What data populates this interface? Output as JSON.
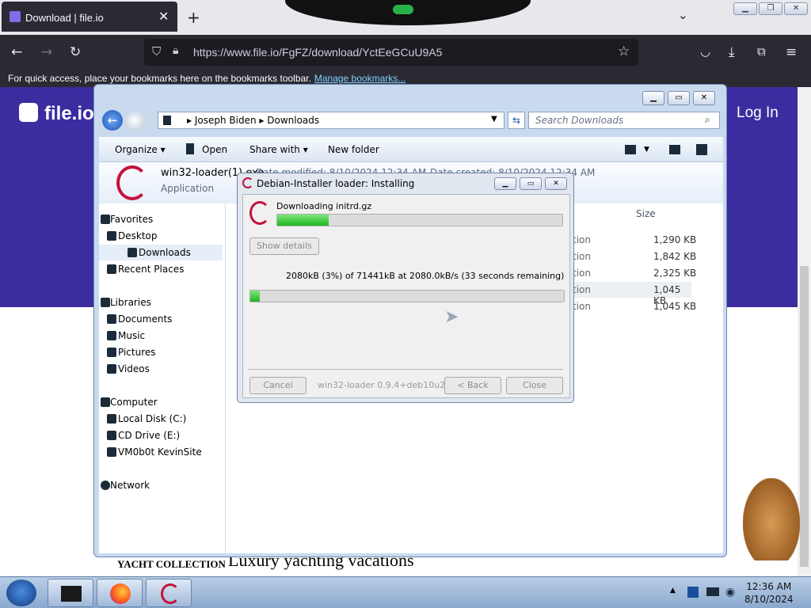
{
  "browser": {
    "tab_title": "Download | file.io",
    "new_tab": "+",
    "url": "https://www.file.io/FgFZ/download/YctEeGCuU9A5",
    "bookmarks_text": "For quick access, place your bookmarks here on the bookmarks toolbar.",
    "bookmarks_link": "Manage bookmarks..."
  },
  "site": {
    "logo": "file.io",
    "login": "Log In",
    "yacht_a": "YACHT COLLECTION",
    "yacht_b": "Luxury yachting vacations"
  },
  "explorer": {
    "breadcrumb": [
      "Joseph Biden",
      "Downloads"
    ],
    "search_placeholder": "Search Downloads",
    "commands": [
      "Organize ▾",
      "Open",
      "Share with ▾",
      "New folder"
    ],
    "selected_file": {
      "name": "win32-loader(1).exe",
      "type": "Application",
      "date_modified": "Date modified: 8/10/2024 12:34 AM",
      "date_created": "Date created: 8/10/2024 12:34 AM"
    },
    "nav": {
      "favorites": "Favorites",
      "fav_items": [
        "Desktop",
        "Downloads",
        "Recent Places"
      ],
      "libraries": "Libraries",
      "lib_items": [
        "Documents",
        "Music",
        "Pictures",
        "Videos"
      ],
      "computer": "Computer",
      "comp_items": [
        "Local Disk (C:)",
        "CD Drive (E:)",
        "VM0b0t KevinSite"
      ],
      "network": "Network"
    },
    "size_header": "Size",
    "rows": [
      {
        "type": "tion",
        "size": "1,290 KB"
      },
      {
        "type": "tion",
        "size": "1,842 KB"
      },
      {
        "type": "tion",
        "size": "2,325 KB"
      },
      {
        "type": "tion",
        "size": "1,045 KB"
      },
      {
        "type": "tion",
        "size": "1,045 KB"
      }
    ]
  },
  "dialog": {
    "title": "Debian-Installer loader: Installing",
    "status": "Downloading initrd.gz",
    "status_progress": 0.18,
    "show_details": "Show details",
    "transfer": "2080kB (3%) of 71441kB at 2080.0kB/s (33 seconds remaining)",
    "transfer_progress": 0.03,
    "cancel": "Cancel",
    "version": "win32-loader 0.9.4+deb10u2",
    "back": "< Back",
    "close": "Close"
  },
  "taskbar": {
    "time": "12:36 AM",
    "date": "8/10/2024"
  }
}
